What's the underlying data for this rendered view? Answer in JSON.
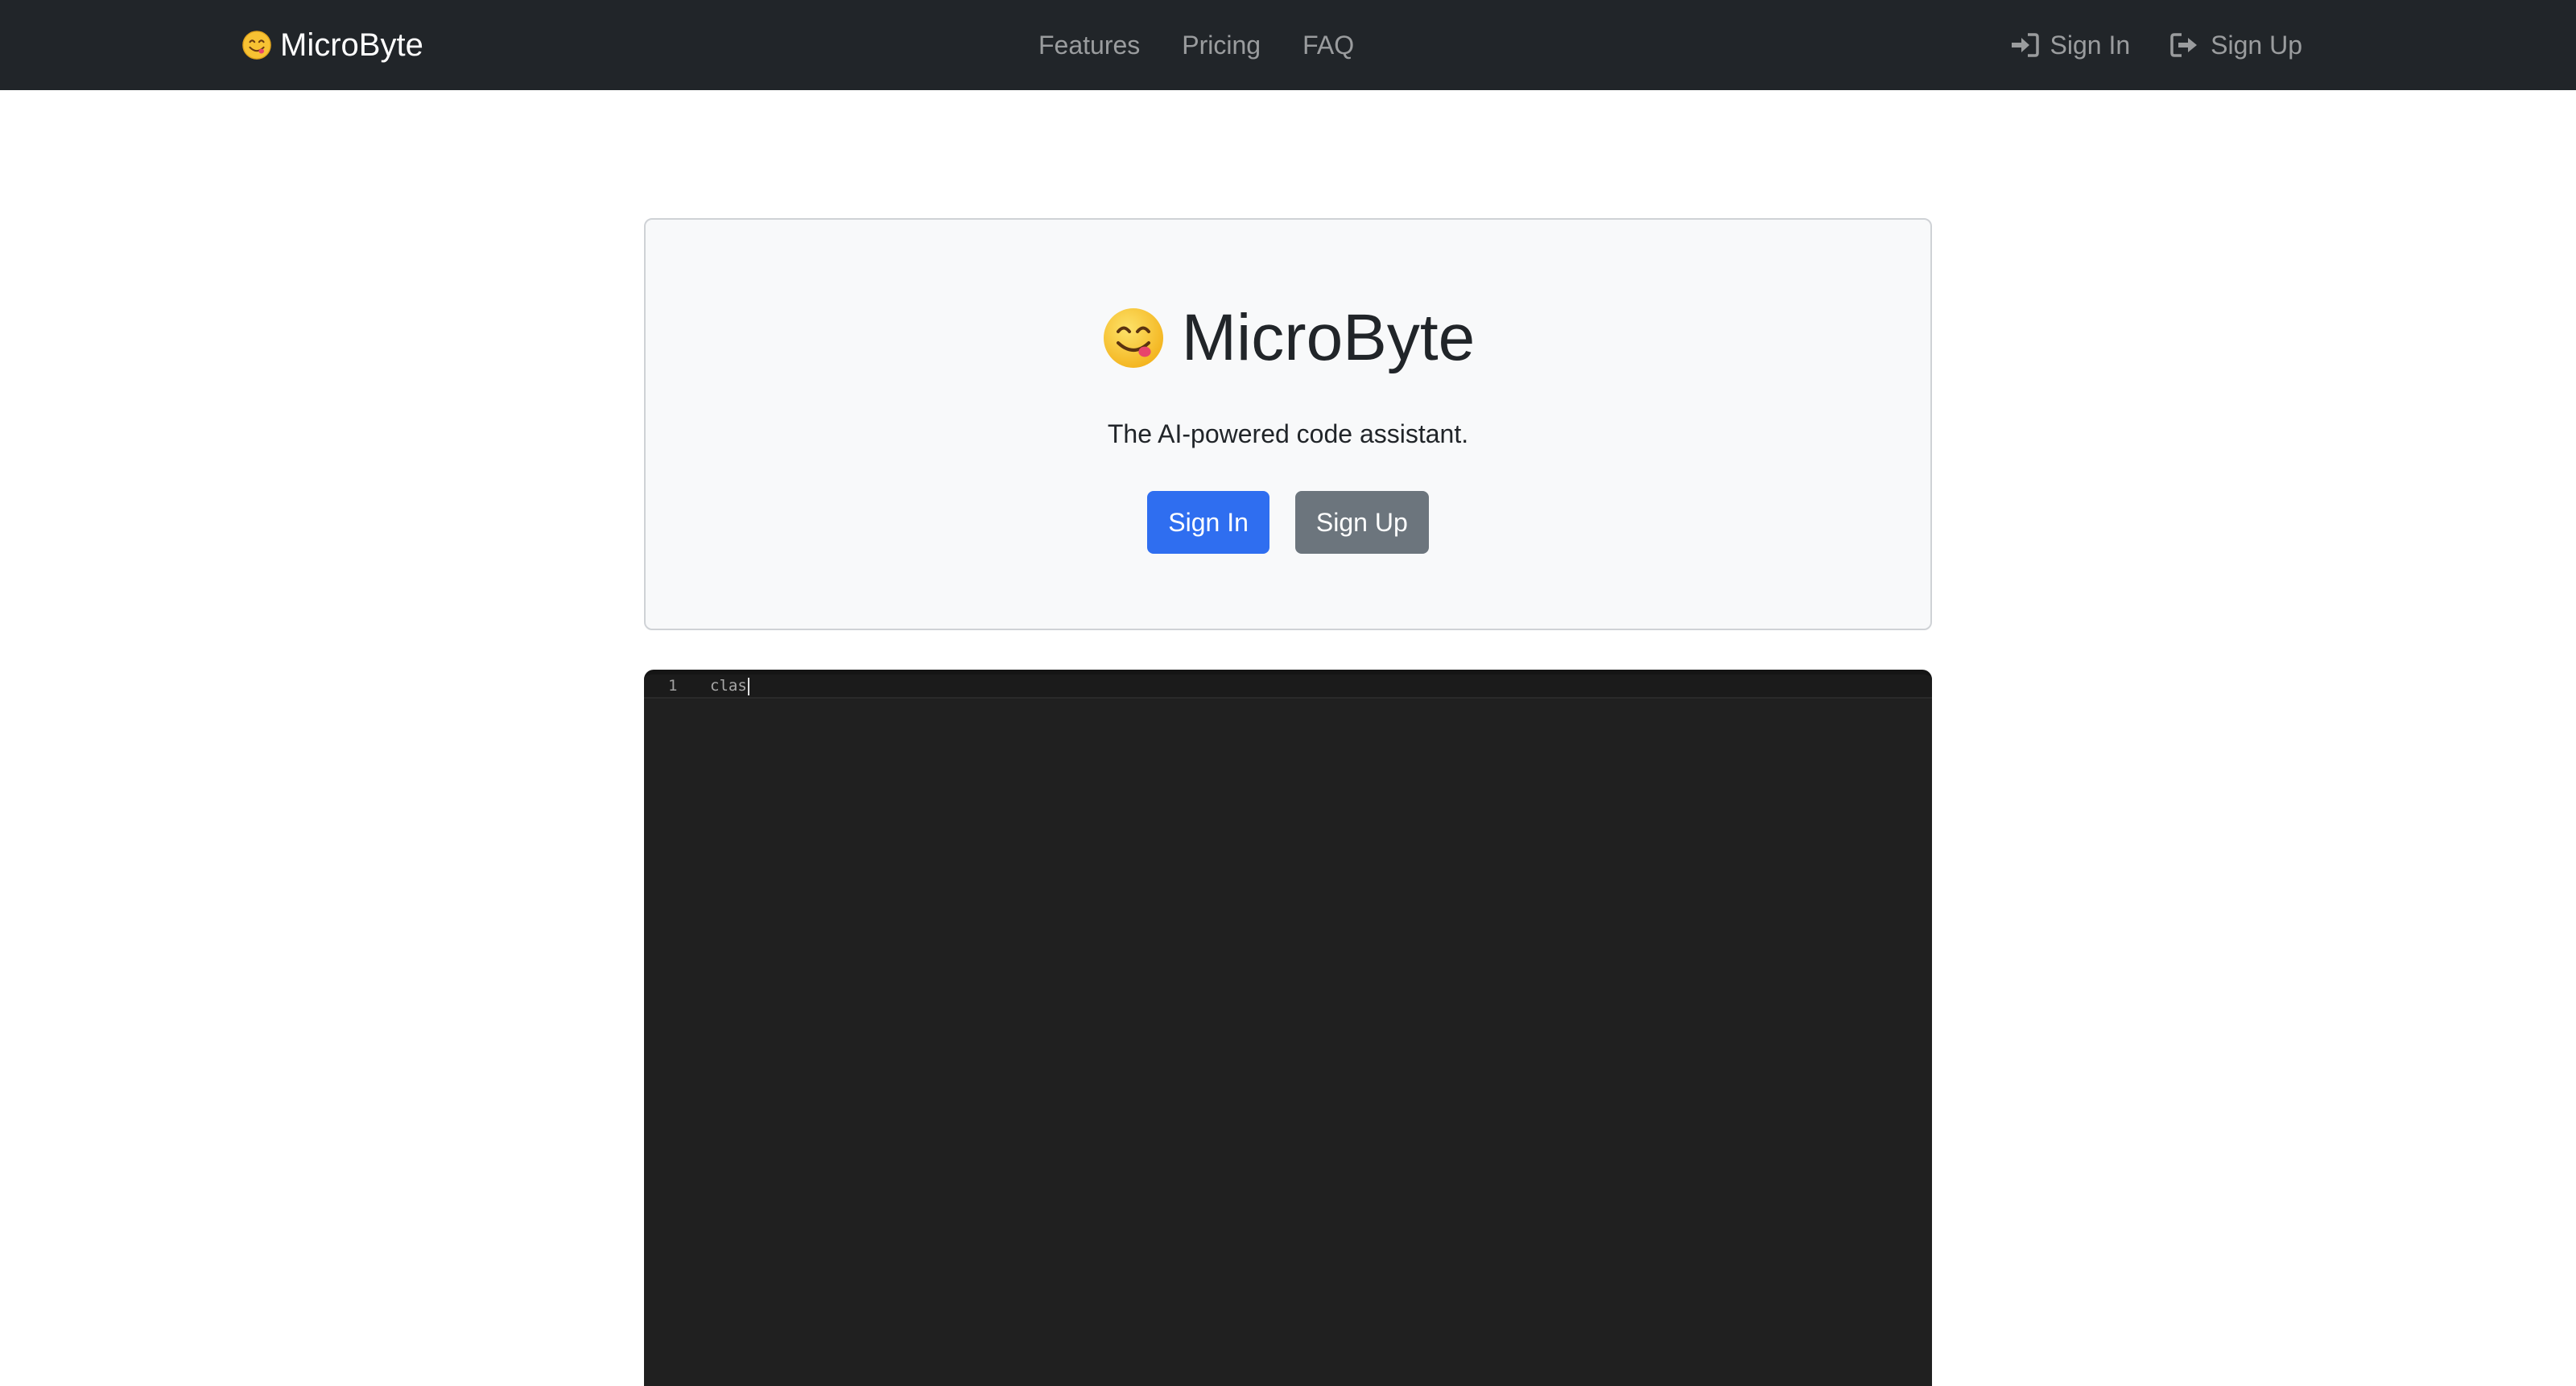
{
  "navbar": {
    "brand_label": "MicroByte",
    "brand_icon": "smiling-face-emoji-icon",
    "links": [
      {
        "label": "Features"
      },
      {
        "label": "Pricing"
      },
      {
        "label": "FAQ"
      }
    ],
    "sign_in_label": "Sign In",
    "sign_up_label": "Sign Up",
    "sign_in_icon": "sign-in-icon",
    "sign_up_icon": "sign-out-icon",
    "background": "#212529"
  },
  "hero": {
    "title": "MicroByte",
    "subtitle": "The AI-powered code assistant.",
    "sign_in_button": "Sign In",
    "sign_up_button": "Sign Up",
    "primary_color": "#2f6ef0",
    "secondary_color": "#6c757d"
  },
  "editor": {
    "lines": [
      {
        "number": "1",
        "code": "clas"
      }
    ],
    "background": "#202020"
  }
}
